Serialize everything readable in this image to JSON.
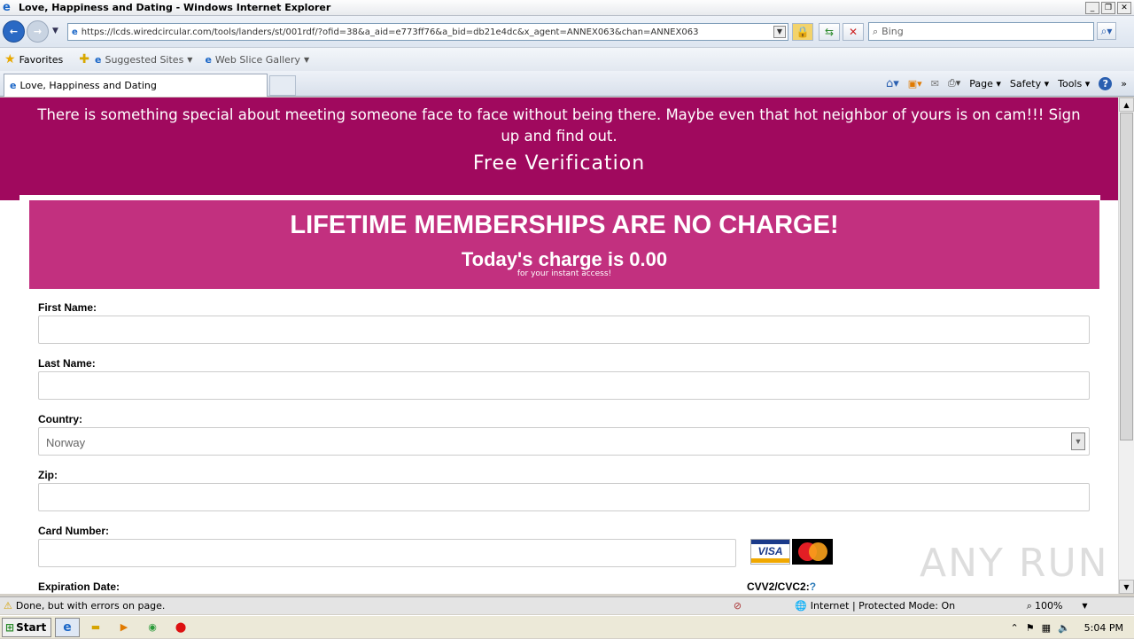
{
  "window": {
    "title": "Love, Happiness and Dating - Windows Internet Explorer"
  },
  "nav": {
    "url": "https://lcds.wiredcircular.com/tools/landers/st/001rdf/?ofid=38&a_aid=e773ff76&a_bid=db21e4dc&x_agent=ANNEX063&chan=ANNEX063",
    "search_placeholder": "Bing"
  },
  "favorites": {
    "label": "Favorites",
    "items": [
      "Suggested Sites",
      "Web Slice Gallery"
    ]
  },
  "tab": {
    "label": "Love, Happiness and Dating"
  },
  "commands": {
    "page": "Page",
    "safety": "Safety",
    "tools": "Tools"
  },
  "hero": {
    "intro": "There is something special about meeting someone face to face without being there. Maybe even that hot neighbor of yours is on cam!!! Sign up and find out.",
    "subtitle": "Free Verification"
  },
  "banner": {
    "headline": "LIFETIME MEMBERSHIPS ARE NO CHARGE!",
    "charge": "Today's charge is 0.00",
    "note": "for your instant access!"
  },
  "form": {
    "first_name_label": "First Name:",
    "last_name_label": "Last Name:",
    "country_label": "Country:",
    "country_value": "Norway",
    "zip_label": "Zip:",
    "card_label": "Card Number:",
    "expiry_label": "Expiration Date:",
    "cvv_label": "CVV2/CVC2:",
    "cvv_help": "?",
    "visa_text": "VISA"
  },
  "watermark": "ANY RUN",
  "status": {
    "message": "Done, but with errors on page.",
    "zone": "Internet | Protected Mode: On",
    "zoom": "100%"
  },
  "taskbar": {
    "start": "Start",
    "time": "5:04 PM"
  }
}
